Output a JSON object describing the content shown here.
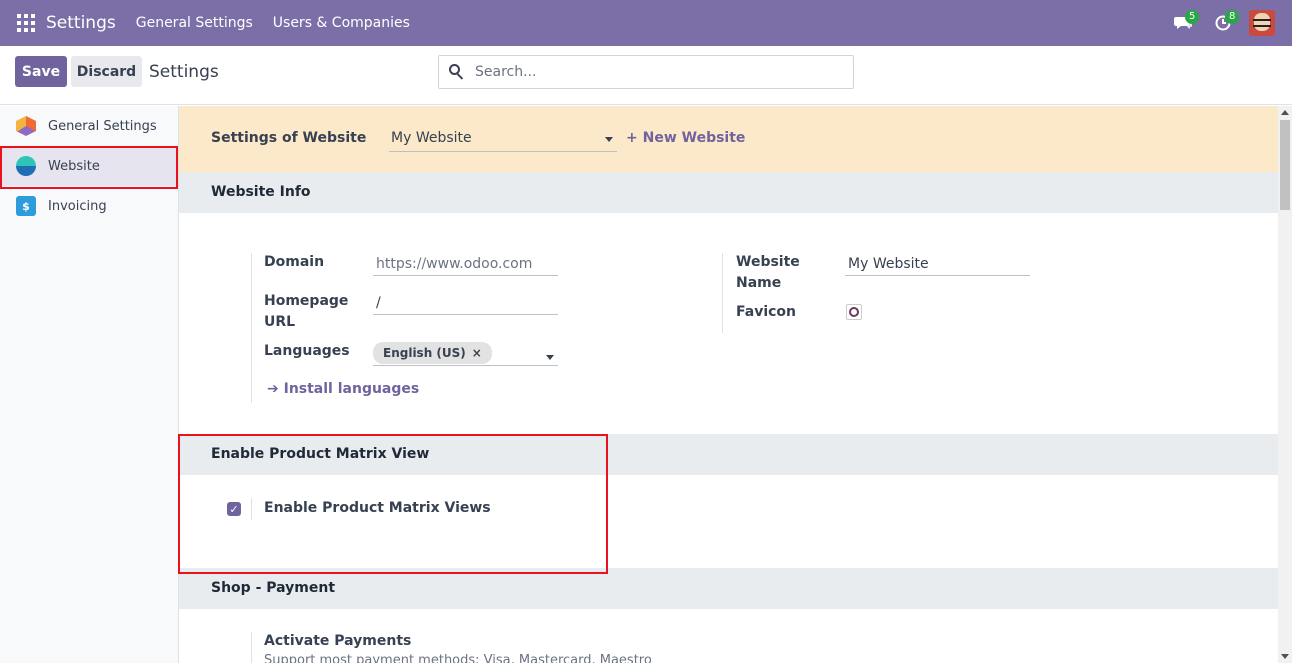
{
  "navbar": {
    "brand": "Settings",
    "menu": [
      "General Settings",
      "Users & Companies"
    ],
    "messages_count": "5",
    "activities_count": "8"
  },
  "control_panel": {
    "save_label": "Save",
    "discard_label": "Discard",
    "title": "Settings",
    "search_placeholder": "Search..."
  },
  "sidebar": {
    "items": [
      {
        "label": "General Settings",
        "icon": "general-settings-icon"
      },
      {
        "label": "Website",
        "icon": "website-icon"
      },
      {
        "label": "Invoicing",
        "icon": "invoicing-icon"
      }
    ],
    "active": "Website"
  },
  "banner": {
    "label": "Settings of Website",
    "selected_website": "My Website",
    "new_website": "+ New Website"
  },
  "website_info": {
    "heading": "Website Info",
    "domain_label": "Domain",
    "domain_placeholder": "https://www.odoo.com",
    "homepage_label_1": "Homepage",
    "homepage_label_2": "URL",
    "homepage_value": "/",
    "languages_label": "Languages",
    "language_tag": "English (US)",
    "install_languages": "Install languages",
    "website_name_label_1": "Website",
    "website_name_label_2": "Name",
    "website_name_value": "My Website",
    "favicon_label": "Favicon"
  },
  "matrix": {
    "heading": "Enable Product Matrix View",
    "checkbox_label": "Enable Product Matrix Views",
    "checked": true
  },
  "shop_payment": {
    "heading": "Shop - Payment",
    "activate_label": "Activate Payments",
    "activate_desc": "Support most payment methods; Visa, Mastercard, Maestro"
  },
  "colors": {
    "navbar": "#7c6fa7",
    "primary": "#71639e",
    "highlight": "#e8131c",
    "banner": "#fbe9c9"
  }
}
